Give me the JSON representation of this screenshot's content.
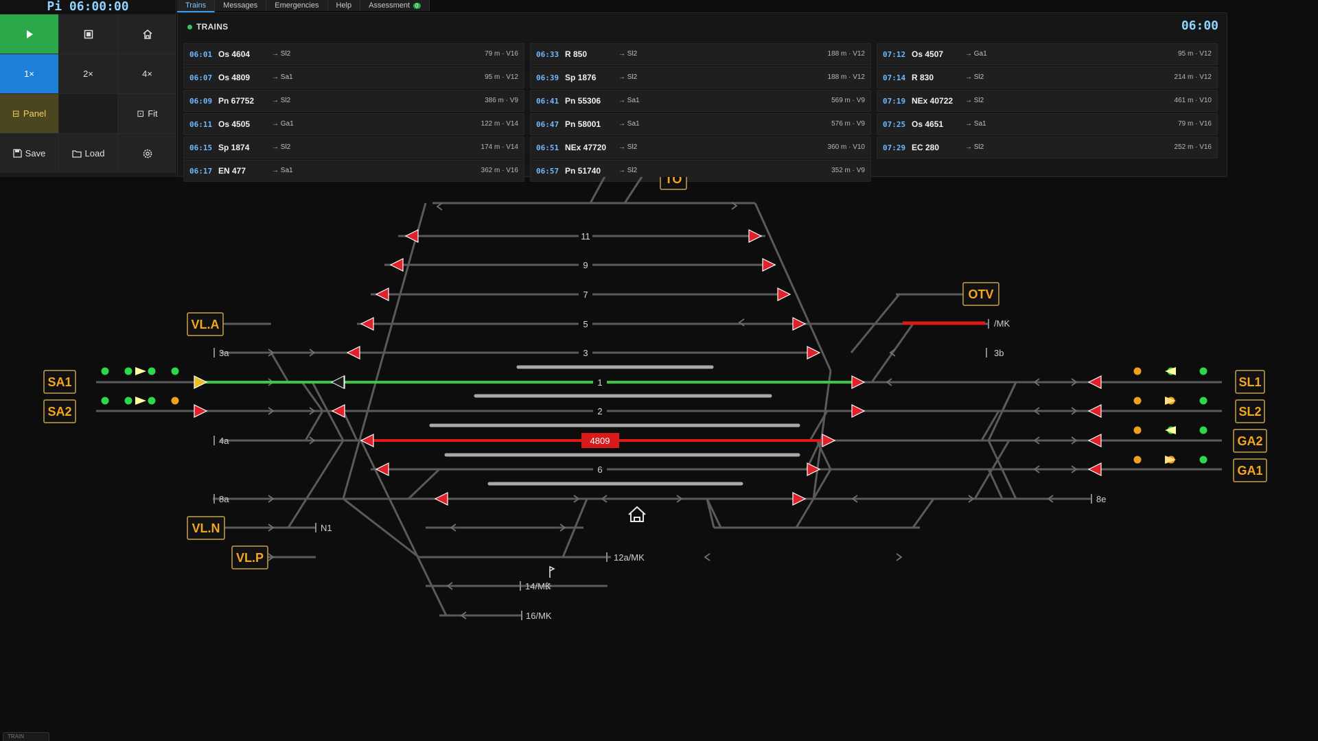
{
  "clock": "Pi 06:00:00",
  "controls": {
    "speeds": [
      "1×",
      "2×",
      "4×"
    ],
    "panel_label": "Panel",
    "fit_label": "Fit",
    "save_label": "Save",
    "load_label": "Load"
  },
  "tabs": [
    {
      "label": "Trains"
    },
    {
      "label": "Messages"
    },
    {
      "label": "Emergencies"
    },
    {
      "label": "Help"
    },
    {
      "label": "Assessment",
      "badge": "0"
    }
  ],
  "trains_panel": {
    "title": "TRAINS",
    "time": "06:00",
    "columns": [
      [
        {
          "time": "06:01",
          "name": "Os 4604",
          "dest": "→ Sl2",
          "info": "79 m · V16"
        },
        {
          "time": "06:07",
          "name": "Os 4809",
          "dest": "→ Sa1",
          "info": "95 m · V12"
        },
        {
          "time": "06:09",
          "name": "Pn 67752",
          "dest": "→ Sl2",
          "info": "386 m · V9"
        },
        {
          "time": "06:11",
          "name": "Os 4505",
          "dest": "→ Ga1",
          "info": "122 m · V14"
        },
        {
          "time": "06:15",
          "name": "Sp 1874",
          "dest": "→ Sl2",
          "info": "174 m · V14"
        },
        {
          "time": "06:17",
          "name": "EN 477",
          "dest": "→ Sa1",
          "info": "362 m · V16"
        }
      ],
      [
        {
          "time": "06:33",
          "name": "R 850",
          "dest": "→ Sl2",
          "info": "188 m · V12"
        },
        {
          "time": "06:39",
          "name": "Sp 1876",
          "dest": "→ Sl2",
          "info": "188 m · V12"
        },
        {
          "time": "06:41",
          "name": "Pn 55306",
          "dest": "→ Sa1",
          "info": "569 m · V9"
        },
        {
          "time": "06:47",
          "name": "Pn 58001",
          "dest": "→ Sa1",
          "info": "576 m · V9"
        },
        {
          "time": "06:51",
          "name": "NEx 47720",
          "dest": "→ Sl2",
          "info": "360 m · V10"
        },
        {
          "time": "06:57",
          "name": "Pn 51740",
          "dest": "→ Sl2",
          "info": "352 m · V9"
        }
      ],
      [
        {
          "time": "07:12",
          "name": "Os 4507",
          "dest": "→ Ga1",
          "info": "95 m · V12"
        },
        {
          "time": "07:14",
          "name": "R 830",
          "dest": "→ Sl2",
          "info": "214 m · V12"
        },
        {
          "time": "07:19",
          "name": "NEx 40722",
          "dest": "→ Sl2",
          "info": "461 m · V10"
        },
        {
          "time": "07:25",
          "name": "Os 4651",
          "dest": "→ Sa1",
          "info": "79 m · V16"
        },
        {
          "time": "07:29",
          "name": "EC 280",
          "dest": "→ Sl2",
          "info": "252 m · V16"
        }
      ]
    ]
  },
  "map": {
    "stations": {
      "sa1": "SA1",
      "sa2": "SA2",
      "vla": "VL.A",
      "vln": "VL.N",
      "vlp": "VL.P",
      "to": "TO",
      "otv": "OTV",
      "sl1": "SL1",
      "sl2": "SL2",
      "ga2": "GA2",
      "ga1": "GA1"
    },
    "track_labels": {
      "t11": "11",
      "t9": "9",
      "t7": "7",
      "t5": "5",
      "t3": "3",
      "t1": "1",
      "t2": "2",
      "t6": "6",
      "t3a": "3a",
      "t4a": "4a",
      "t8a": "8a",
      "t3b": "3b",
      "t8e": "8e",
      "mk": "/MK",
      "n1": "N1",
      "t12a": "12a/MK",
      "t14": "14/MK",
      "t16": "16/MK"
    },
    "occupied_train": "4809",
    "colors": {
      "route": "#3cc83c",
      "occupied": "#e01818",
      "track": "#5a5a5a",
      "station": "#f4a61c"
    }
  },
  "minimap_label": "TRAIN"
}
